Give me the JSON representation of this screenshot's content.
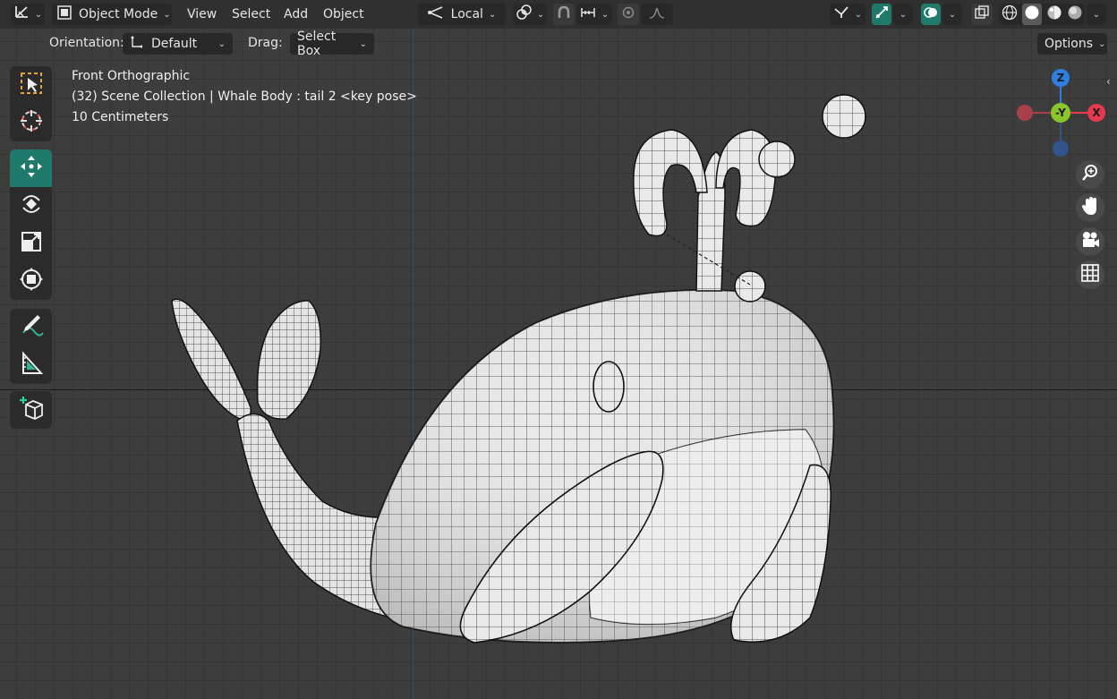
{
  "header": {
    "mode_label": "Object Mode",
    "menu_view": "View",
    "menu_select": "Select",
    "menu_add": "Add",
    "menu_object": "Object",
    "transform_orientation": "Local",
    "options_label": "Options"
  },
  "tool_settings": {
    "orientation_label": "Orientation:",
    "orientation_value": "Default",
    "drag_label": "Drag:",
    "drag_value": "Select Box"
  },
  "viewport": {
    "view_name": "Front Orthographic",
    "collection_info": "(32) Scene Collection | Whale Body : tail 2 <key pose>",
    "scale_info": "10 Centimeters"
  },
  "gizmo": {
    "z_label": "Z",
    "y_label": "-Y",
    "x_label": "X",
    "colors": {
      "x": "#e8394f",
      "y": "#8ac52a",
      "z": "#2f7fe0"
    }
  },
  "toolbar": {
    "tools": [
      "select-box",
      "cursor",
      "move",
      "rotate",
      "scale",
      "transform",
      "annotate",
      "measure",
      "add-cube"
    ],
    "active_tool": "move"
  },
  "icons": {
    "editor_type": "axes-icon",
    "mode": "object-mode-icon",
    "pivot": "pivot-icon",
    "snap": "magnet-icon",
    "proportional": "proportional-icon",
    "shading": "solid-shading-icon"
  },
  "colors": {
    "accent": "#1f7a6b",
    "header_bg": "#303030",
    "viewport_bg": "#3d3d3d"
  }
}
